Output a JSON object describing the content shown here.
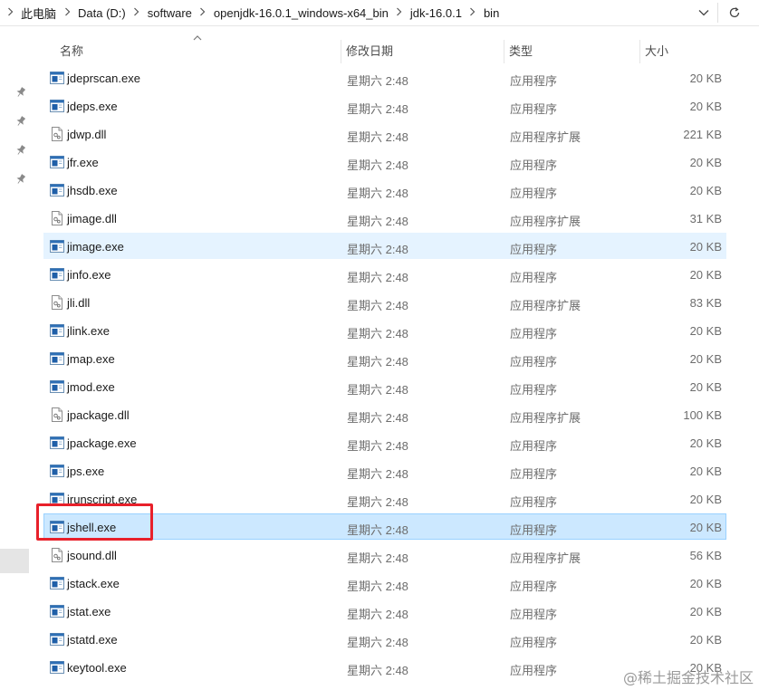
{
  "address_bar": {
    "breadcrumbs": [
      "此电脑",
      "Data (D:)",
      "software",
      "openjdk-16.0.1_windows-x64_bin",
      "jdk-16.0.1",
      "bin"
    ]
  },
  "columns": {
    "name": "名称",
    "date": "修改日期",
    "type": "类型",
    "size": "大小"
  },
  "files": [
    {
      "name": "jdeprscan.exe",
      "date": "星期六 2:48",
      "type": "应用程序",
      "size": "20 KB",
      "icon": "exe-icon",
      "state": "normal"
    },
    {
      "name": "jdeps.exe",
      "date": "星期六 2:48",
      "type": "应用程序",
      "size": "20 KB",
      "icon": "exe-icon",
      "state": "normal"
    },
    {
      "name": "jdwp.dll",
      "date": "星期六 2:48",
      "type": "应用程序扩展",
      "size": "221 KB",
      "icon": "dll-icon",
      "state": "normal"
    },
    {
      "name": "jfr.exe",
      "date": "星期六 2:48",
      "type": "应用程序",
      "size": "20 KB",
      "icon": "exe-icon",
      "state": "normal"
    },
    {
      "name": "jhsdb.exe",
      "date": "星期六 2:48",
      "type": "应用程序",
      "size": "20 KB",
      "icon": "exe-icon",
      "state": "normal"
    },
    {
      "name": "jimage.dll",
      "date": "星期六 2:48",
      "type": "应用程序扩展",
      "size": "31 KB",
      "icon": "dll-icon",
      "state": "normal"
    },
    {
      "name": "jimage.exe",
      "date": "星期六 2:48",
      "type": "应用程序",
      "size": "20 KB",
      "icon": "exe-icon",
      "state": "hover"
    },
    {
      "name": "jinfo.exe",
      "date": "星期六 2:48",
      "type": "应用程序",
      "size": "20 KB",
      "icon": "exe-icon",
      "state": "normal"
    },
    {
      "name": "jli.dll",
      "date": "星期六 2:48",
      "type": "应用程序扩展",
      "size": "83 KB",
      "icon": "dll-icon",
      "state": "normal"
    },
    {
      "name": "jlink.exe",
      "date": "星期六 2:48",
      "type": "应用程序",
      "size": "20 KB",
      "icon": "exe-icon",
      "state": "normal"
    },
    {
      "name": "jmap.exe",
      "date": "星期六 2:48",
      "type": "应用程序",
      "size": "20 KB",
      "icon": "exe-icon",
      "state": "normal"
    },
    {
      "name": "jmod.exe",
      "date": "星期六 2:48",
      "type": "应用程序",
      "size": "20 KB",
      "icon": "exe-icon",
      "state": "normal"
    },
    {
      "name": "jpackage.dll",
      "date": "星期六 2:48",
      "type": "应用程序扩展",
      "size": "100 KB",
      "icon": "dll-icon",
      "state": "normal"
    },
    {
      "name": "jpackage.exe",
      "date": "星期六 2:48",
      "type": "应用程序",
      "size": "20 KB",
      "icon": "exe-icon",
      "state": "normal"
    },
    {
      "name": "jps.exe",
      "date": "星期六 2:48",
      "type": "应用程序",
      "size": "20 KB",
      "icon": "exe-icon",
      "state": "normal"
    },
    {
      "name": "jrunscript.exe",
      "date": "星期六 2:48",
      "type": "应用程序",
      "size": "20 KB",
      "icon": "exe-icon",
      "state": "normal"
    },
    {
      "name": "jshell.exe",
      "date": "星期六 2:48",
      "type": "应用程序",
      "size": "20 KB",
      "icon": "exe-icon",
      "state": "selected"
    },
    {
      "name": "jsound.dll",
      "date": "星期六 2:48",
      "type": "应用程序扩展",
      "size": "56 KB",
      "icon": "dll-icon",
      "state": "normal"
    },
    {
      "name": "jstack.exe",
      "date": "星期六 2:48",
      "type": "应用程序",
      "size": "20 KB",
      "icon": "exe-icon",
      "state": "normal"
    },
    {
      "name": "jstat.exe",
      "date": "星期六 2:48",
      "type": "应用程序",
      "size": "20 KB",
      "icon": "exe-icon",
      "state": "normal"
    },
    {
      "name": "jstatd.exe",
      "date": "星期六 2:48",
      "type": "应用程序",
      "size": "20 KB",
      "icon": "exe-icon",
      "state": "normal"
    },
    {
      "name": "keytool.exe",
      "date": "星期六 2:48",
      "type": "应用程序",
      "size": "20 KB",
      "icon": "exe-icon",
      "state": "normal"
    }
  ],
  "watermark": "@稀土掘金技术社区",
  "colors": {
    "hover_bg": "#e5f3ff",
    "selected_bg": "#cce8ff",
    "selected_border": "#99d1ff",
    "annotation": "#e8202a"
  }
}
